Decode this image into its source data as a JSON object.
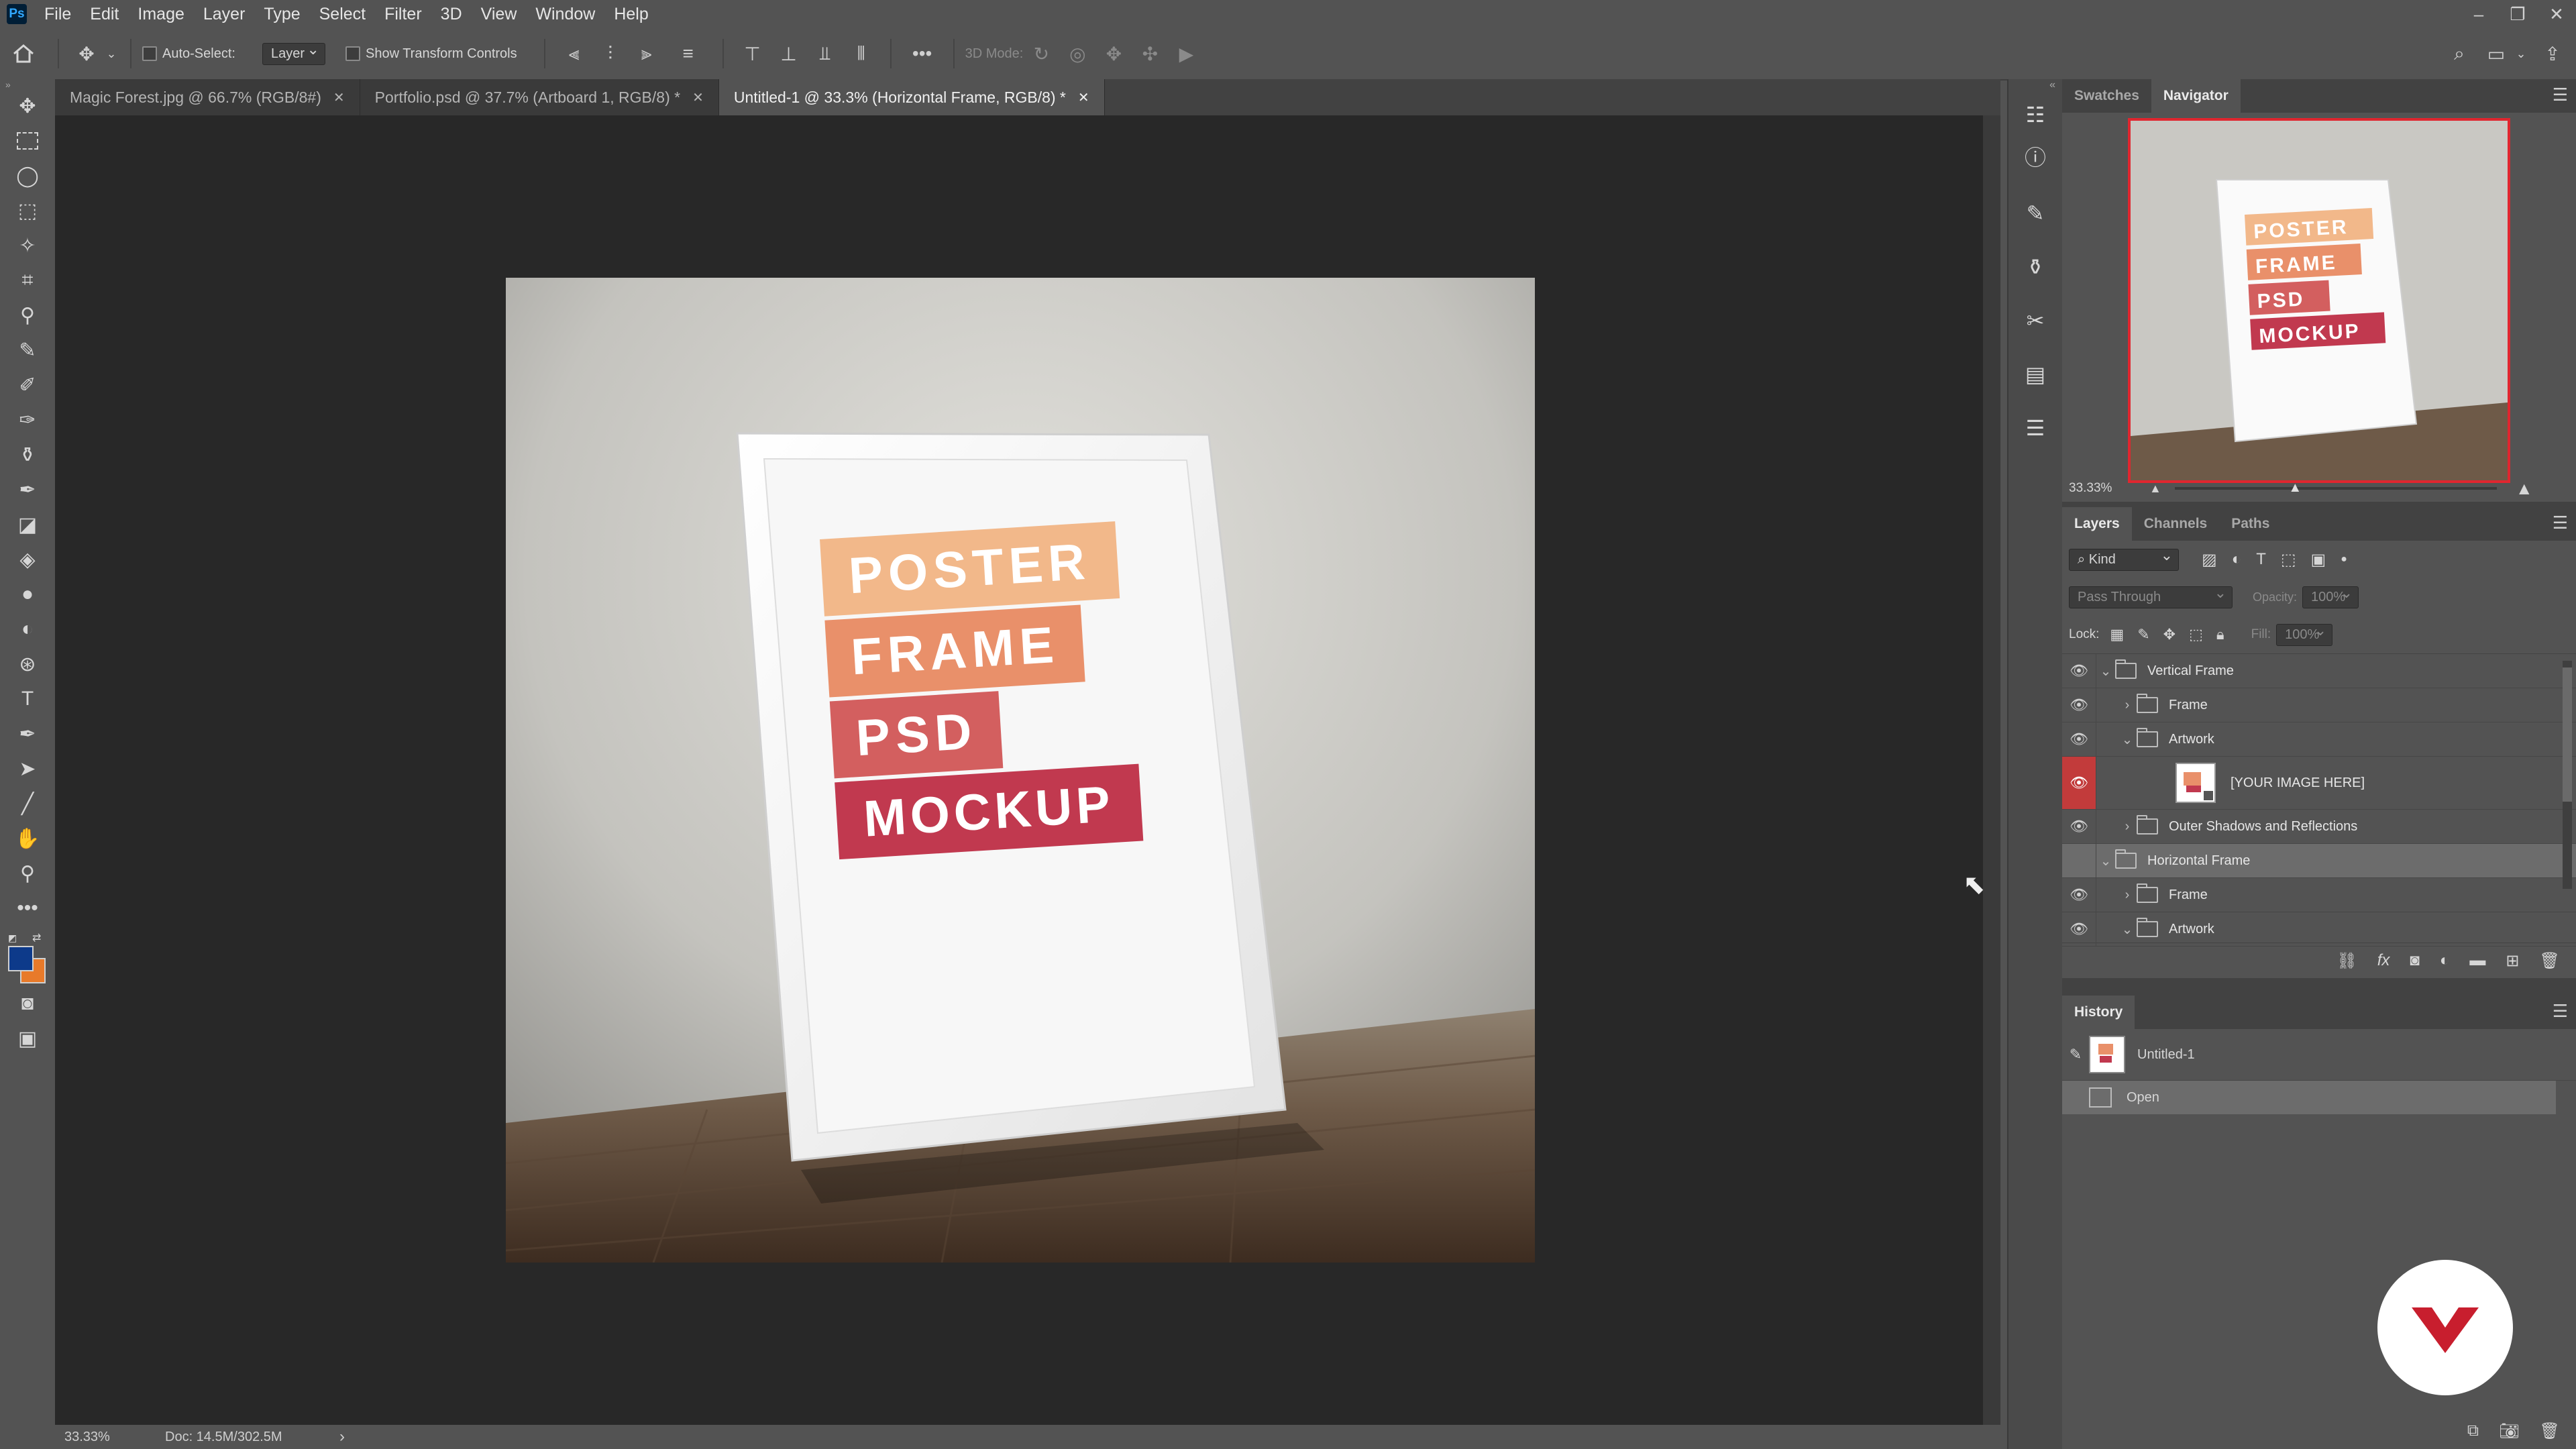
{
  "app": {
    "logo_text": "Ps"
  },
  "menu": [
    "File",
    "Edit",
    "Image",
    "Layer",
    "Type",
    "Select",
    "Filter",
    "3D",
    "View",
    "Window",
    "Help"
  ],
  "window_controls": [
    "–",
    "❐",
    "✕"
  ],
  "options_bar": {
    "auto_select_label": "Auto-Select:",
    "auto_select_target": "Layer",
    "show_transform_label": "Show Transform Controls",
    "mode_label": "3D Mode:"
  },
  "tabs": [
    {
      "title": "Magic Forest.jpg @ 66.7% (RGB/8#)",
      "active": false
    },
    {
      "title": "Portfolio.psd @ 37.7% (Artboard 1, RGB/8) *",
      "active": false
    },
    {
      "title": "Untitled-1 @ 33.3% (Horizontal Frame, RGB/8) *",
      "active": true
    }
  ],
  "poster": {
    "lines": [
      "POSTER",
      "FRAME",
      "PSD",
      "MOCKUP"
    ],
    "colors": [
      "#f2b88a",
      "#e9906a",
      "#d35f5f",
      "#c1394f"
    ]
  },
  "status": {
    "zoom": "33.33%",
    "doc": "Doc: 14.5M/302.5M",
    "arrow": "›"
  },
  "navigator": {
    "tabs": [
      "Swatches",
      "Navigator"
    ],
    "active_tab": "Navigator",
    "zoom": "33.33%",
    "zoom_slider_fraction": 0.37
  },
  "layers_panel": {
    "tabs": [
      "Layers",
      "Channels",
      "Paths"
    ],
    "filter_kind": "Kind",
    "blend_mode": "Pass Through",
    "opacity_label": "Opacity:",
    "opacity_value": "100%",
    "lock_label": "Lock:",
    "fill_label": "Fill:",
    "fill_value": "100%",
    "layers": [
      {
        "name": "Vertical Frame",
        "indent": 0,
        "expanded": true,
        "visible": true,
        "type": "group"
      },
      {
        "name": "Frame",
        "indent": 1,
        "expanded": false,
        "visible": true,
        "type": "group"
      },
      {
        "name": "Artwork",
        "indent": 1,
        "expanded": true,
        "visible": true,
        "type": "group"
      },
      {
        "name": "[YOUR IMAGE HERE]",
        "indent": 2,
        "visible": true,
        "type": "smart-object",
        "highlight": true
      },
      {
        "name": "Outer Shadows and Reflections",
        "indent": 1,
        "expanded": false,
        "visible": true,
        "type": "group"
      },
      {
        "name": "Horizontal Frame",
        "indent": 0,
        "expanded": true,
        "visible": false,
        "type": "group",
        "selected": true
      },
      {
        "name": "Frame",
        "indent": 1,
        "expanded": false,
        "visible": true,
        "type": "group"
      },
      {
        "name": "Artwork",
        "indent": 1,
        "expanded": true,
        "visible": true,
        "type": "group"
      }
    ]
  },
  "history_panel": {
    "tab": "History",
    "snapshot": "Untitled-1",
    "steps": [
      "Open"
    ]
  },
  "colors": {
    "foreground": "#0d3a8a",
    "background": "#e87a2a",
    "accent_red": "#c81e2e"
  }
}
